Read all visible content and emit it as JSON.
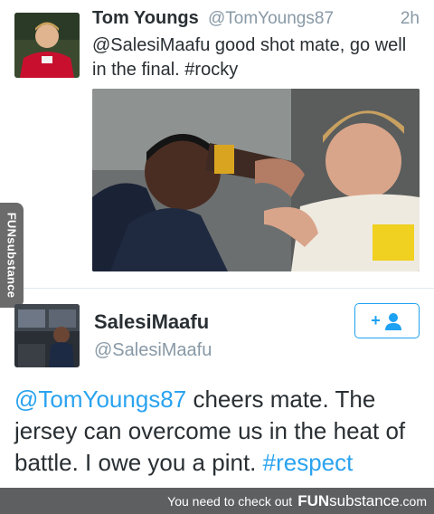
{
  "tweet1": {
    "name": "Tom Youngs",
    "handle": "@TomYoungs87",
    "time": "2h",
    "text": "@SalesiMaafu good shot mate, go well in the final. #rocky"
  },
  "tweet2": {
    "name": "SalesiMaafu",
    "handle": "@SalesiMaafu",
    "text_mention": "@TomYoungs87",
    "text_body": " cheers mate. The jersey can overcome us in the heat of battle. I owe you a pint. ",
    "text_hashtag": "#respect",
    "follow_icon": "add-user-icon"
  },
  "watermark": {
    "side_text": "FUNsubstance",
    "footer_prefix": "You need to check out",
    "footer_brand_bold": "FUN",
    "footer_brand_rest": "substance",
    "footer_domain": ".com"
  },
  "colors": {
    "link_blue": "#2aa3ef",
    "muted_gray": "#8899a6",
    "footer_bg": "#5e5f61"
  }
}
